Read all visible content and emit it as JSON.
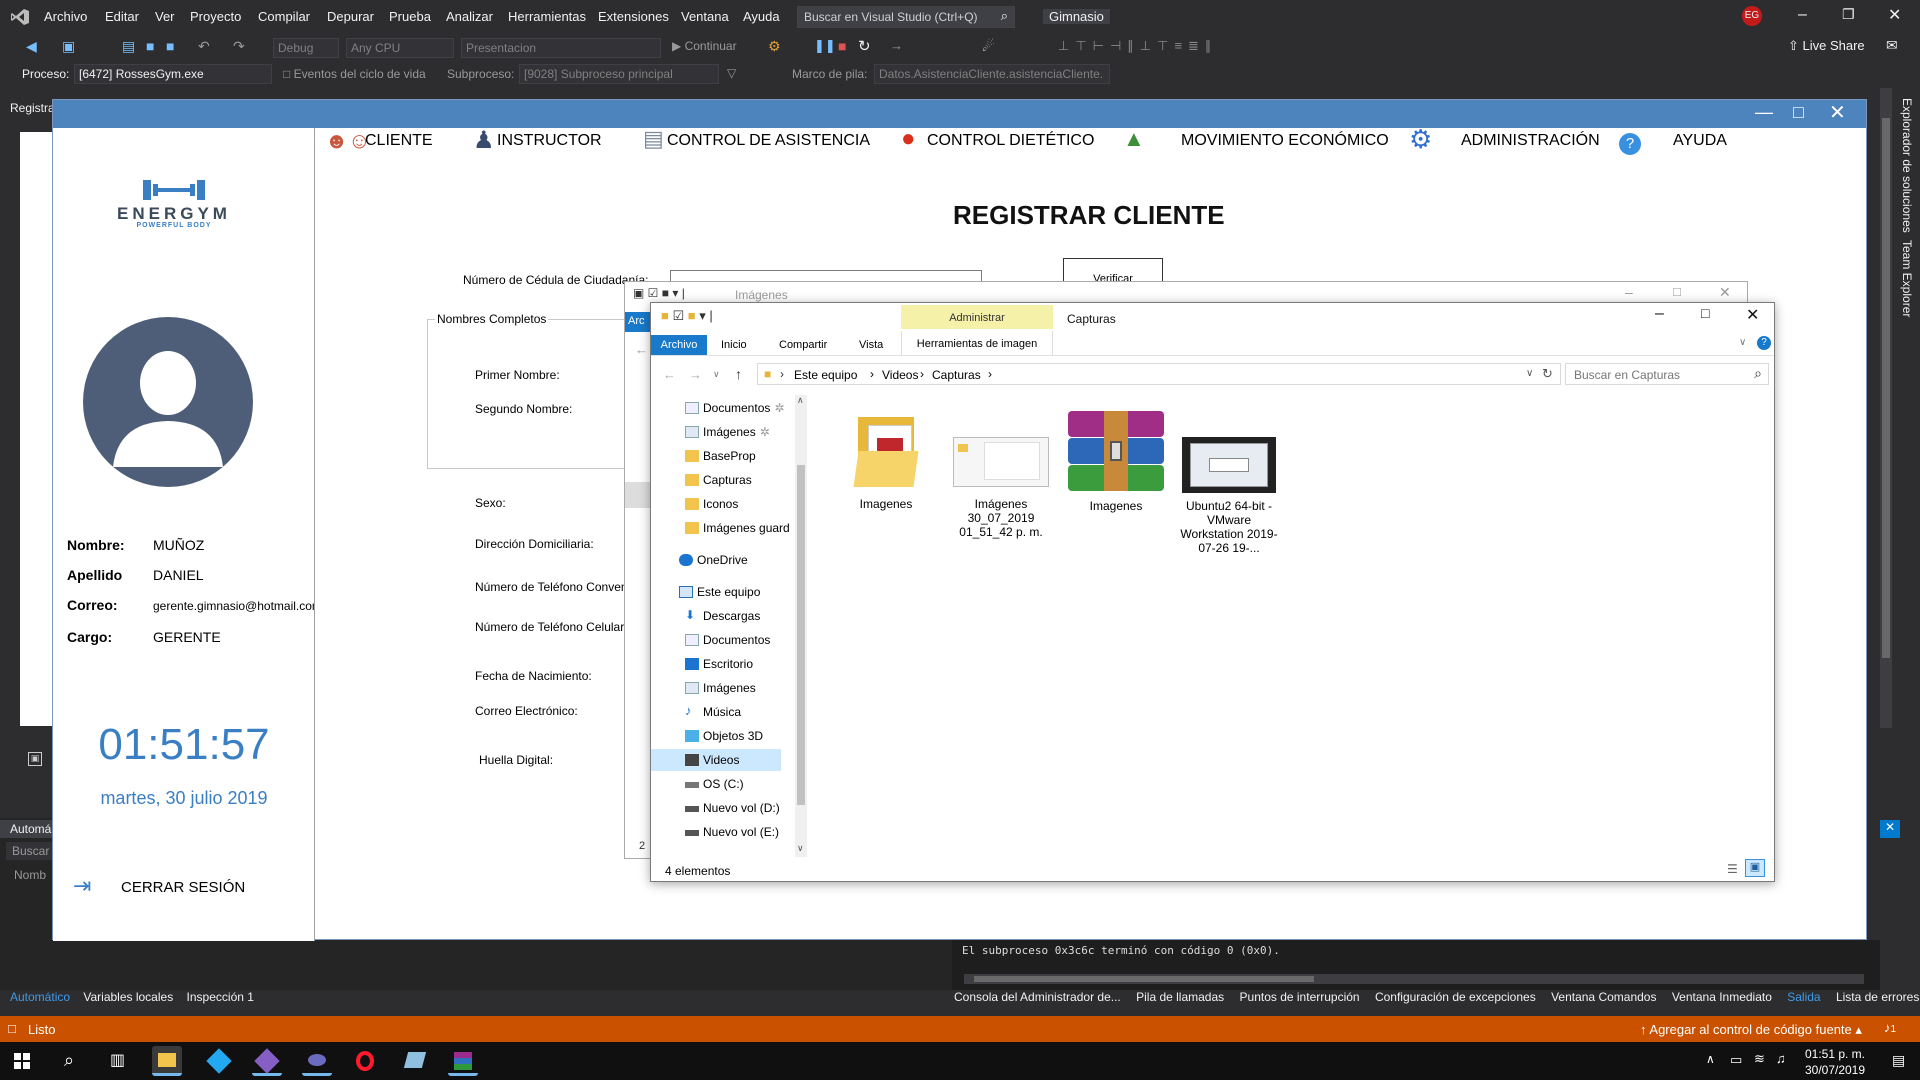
{
  "vs": {
    "menu": [
      "Archivo",
      "Editar",
      "Ver",
      "Proyecto",
      "Compilar",
      "Depurar",
      "Prueba",
      "Analizar",
      "Herramientas",
      "Extensiones",
      "Ventana",
      "Ayuda"
    ],
    "search_placeholder": "Buscar en Visual Studio (Ctrl+Q)",
    "solution_name": "Gimnasio",
    "user_initials": "EG",
    "live_share": "Live Share",
    "config": "Debug",
    "platform": "Any CPU",
    "startup": "Presentacion",
    "continue": "Continuar",
    "process_label": "Proceso:",
    "process_value": "[6472] RossesGym.exe",
    "lifecycle": "Eventos del ciclo de vida",
    "thread_label": "Subproceso:",
    "thread_value": "[9028] Subproceso principal",
    "stack_label": "Marco de pila:",
    "stack_value": "Datos.AsistenciaCliente.asistenciaCliente.",
    "left_tab": "Registra",
    "left_panel_title": "Automá",
    "left_panel_search": "Buscar",
    "left_panel_col": "Nomb",
    "output_line": "El subproceso 0x3c6c terminó con código 0 (0x0).",
    "bottom_tabs_left": [
      "Automático",
      "Variables locales",
      "Inspección 1"
    ],
    "bottom_tabs_right": [
      "Consola del Administrador de...",
      "Pila de llamadas",
      "Puntos de interrupción",
      "Configuración de excepciones",
      "Ventana Comandos",
      "Ventana Inmediato",
      "Salida",
      "Lista de errores"
    ],
    "side_tabs": [
      "Explorador de soluciones",
      "Team Explorer"
    ],
    "status_ready": "Listo",
    "status_source": "Agregar al control de código fuente",
    "status_notifications": "1"
  },
  "app": {
    "brand": "ENERGYM",
    "tagline": "POWERFUL BODY",
    "nav": [
      "CLIENTE",
      "INSTRUCTOR",
      "CONTROL DE ASISTENCIA",
      "CONTROL DIETÉTICO",
      "MOVIMIENTO ECONÓMICO",
      "ADMINISTRACIÓN",
      "AYUDA"
    ],
    "heading": "REGISTRAR CLIENTE",
    "user": {
      "nombre_label": "Nombre:",
      "nombre": "MUÑOZ",
      "apellido_label": "Apellido",
      "apellido": "DANIEL",
      "correo_label": "Correo:",
      "correo": "gerente.gimnasio@hotmail.com",
      "cargo_label": "Cargo:",
      "cargo": "GERENTE"
    },
    "time": "01:51:57",
    "date": "martes, 30 julio 2019",
    "logout": "CERRAR SESIÓN",
    "form": {
      "cedula": "Número de Cédula de Ciudadanía:",
      "verify": "Verificar",
      "group": "Nombres Completos",
      "primer": "Primer Nombre:",
      "segundo": "Segundo Nombre:",
      "sexo": "Sexo:",
      "direccion": "Dirección Domiciliaria:",
      "tel_conv": "Número de Teléfono Convencio",
      "tel_cel": "Número de Teléfono Celular:",
      "nacimiento": "Fecha de Nacimiento:",
      "correo": "Correo Electrónico:",
      "huella": "Huella Digital:"
    }
  },
  "explorer_back": {
    "title": "Imágenes",
    "tab_archivo": "Arc",
    "count": "2"
  },
  "explorer": {
    "title": "Capturas",
    "manage": "Administrar",
    "tabs": [
      "Archivo",
      "Inicio",
      "Compartir",
      "Vista"
    ],
    "tools_tab": "Herramientas de imagen",
    "path": [
      "Este equipo",
      "Videos",
      "Capturas"
    ],
    "search_placeholder": "Buscar en Capturas",
    "quick": [
      "Documentos",
      "Imágenes",
      "BaseProp",
      "Capturas",
      "Iconos",
      "Imágenes guard"
    ],
    "onedrive": "OneDrive",
    "thispc": "Este equipo",
    "pc_items": [
      "Descargas",
      "Documentos",
      "Escritorio",
      "Imágenes",
      "Música",
      "Objetos 3D",
      "Videos",
      "OS (C:)",
      "Nuevo vol (D:)",
      "Nuevo vol (E:)"
    ],
    "files": [
      {
        "name": "Imagenes",
        "type": "folder"
      },
      {
        "name": "Imágenes 30_07_2019 01_51_42 p. m.",
        "type": "screenshot"
      },
      {
        "name": "Imagenes",
        "type": "archive"
      },
      {
        "name": "Ubuntu2 64-bit - VMware Workstation 2019-07-26 19-...",
        "type": "video"
      }
    ],
    "status": "4 elementos"
  },
  "taskbar": {
    "time": "01:51 p. m.",
    "date": "30/07/2019"
  },
  "colors": {
    "vs_bg": "#2d2d30",
    "status_orange": "#ca5100",
    "app_title": "#4d84bd",
    "accent_blue": "#3a7fc3",
    "ribbon_yellow": "#f3efa6"
  }
}
